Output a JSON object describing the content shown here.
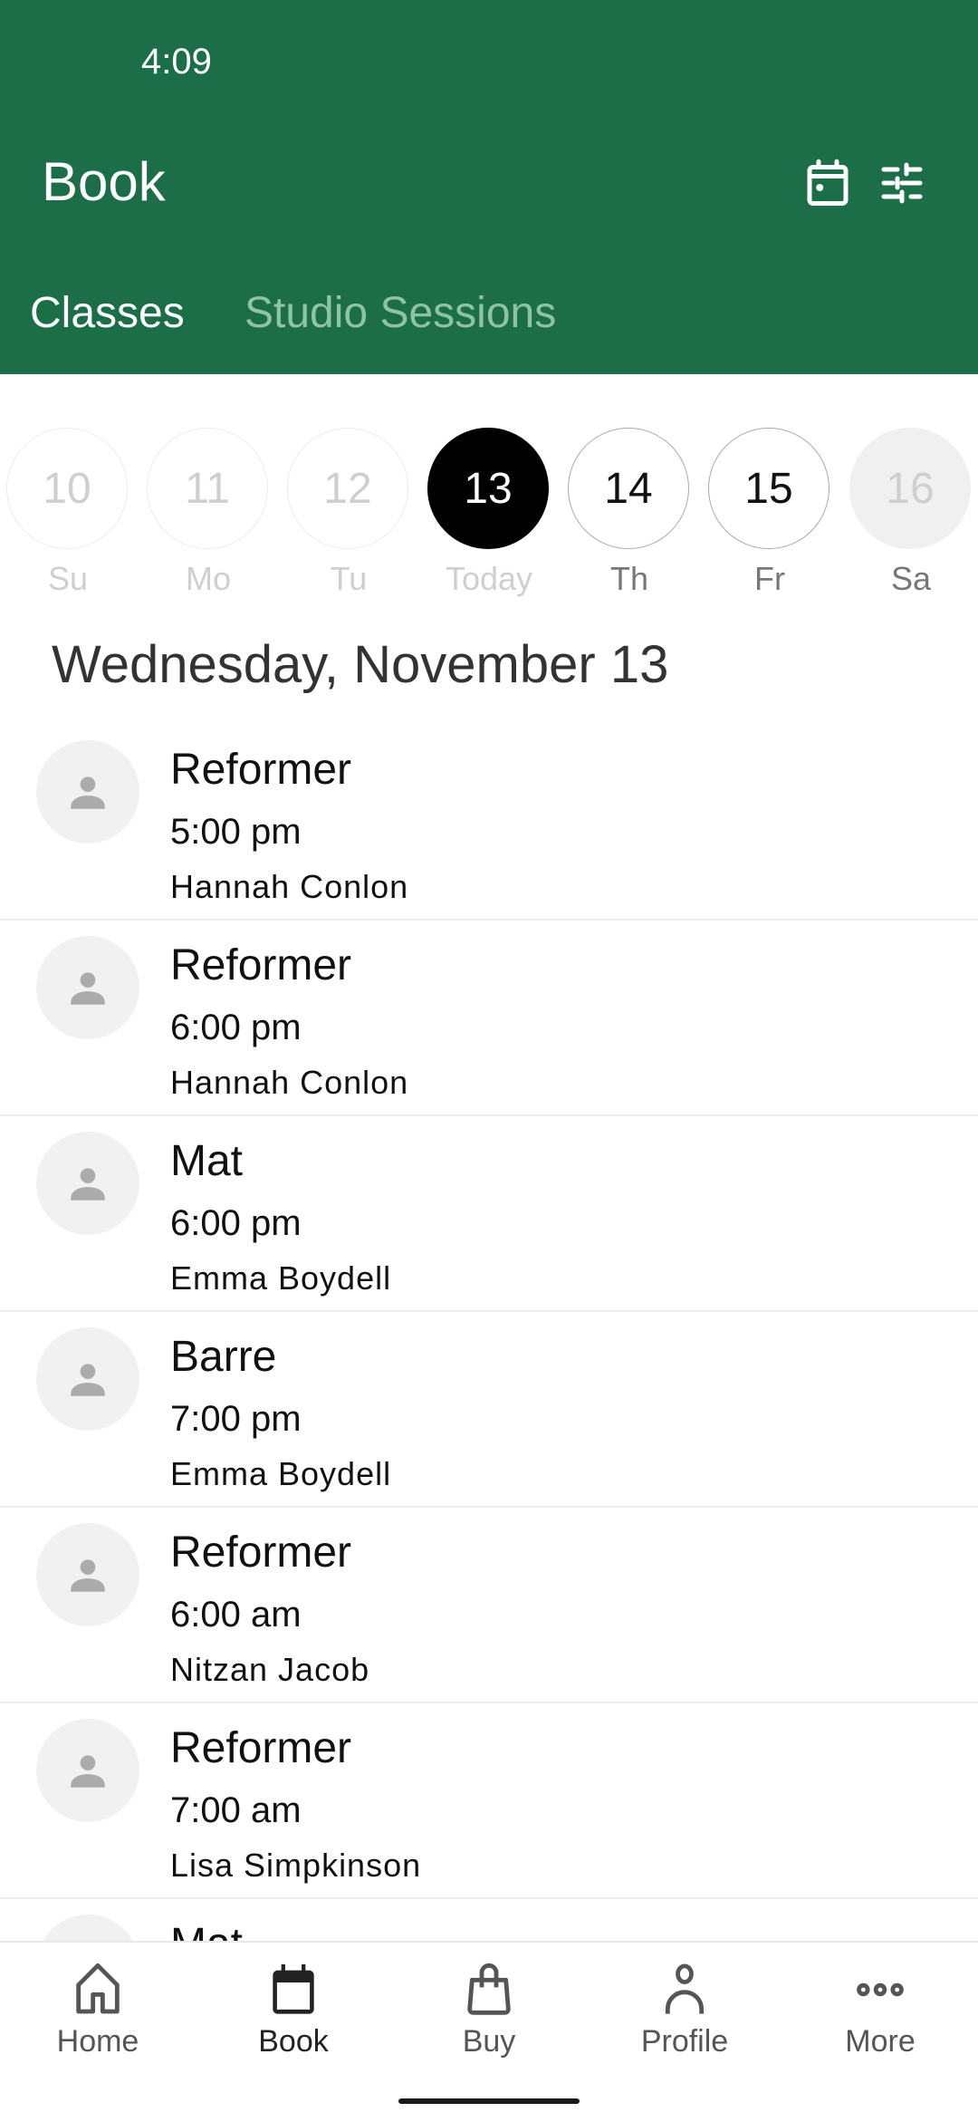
{
  "status_bar": {
    "time": "4:09"
  },
  "header": {
    "title": "Book",
    "icons": [
      "calendar-icon",
      "filter-sliders-icon"
    ],
    "tabs": [
      {
        "label": "Classes",
        "active": true
      },
      {
        "label": "Studio Sessions",
        "active": false
      }
    ],
    "color": "#1b6e47"
  },
  "date_strip": [
    {
      "num": "10",
      "label": "Su",
      "state": "past"
    },
    {
      "num": "11",
      "label": "Mo",
      "state": "past"
    },
    {
      "num": "12",
      "label": "Tu",
      "state": "past"
    },
    {
      "num": "13",
      "label": "Today",
      "state": "selected"
    },
    {
      "num": "14",
      "label": "Th",
      "state": "available"
    },
    {
      "num": "15",
      "label": "Fr",
      "state": "available"
    },
    {
      "num": "16",
      "label": "Sa",
      "state": "unavailable"
    }
  ],
  "date_heading": "Wednesday, November 13",
  "classes": [
    {
      "name": "Reformer",
      "time": "5:00 pm",
      "instructor": "Hannah Conlon"
    },
    {
      "name": "Reformer",
      "time": "6:00 pm",
      "instructor": "Hannah Conlon"
    },
    {
      "name": "Mat",
      "time": "6:00 pm",
      "instructor": "Emma Boydell"
    },
    {
      "name": "Barre",
      "time": "7:00 pm",
      "instructor": "Emma Boydell"
    },
    {
      "name": "Reformer",
      "time": "6:00 am",
      "instructor": "Nitzan Jacob"
    },
    {
      "name": "Reformer",
      "time": "7:00 am",
      "instructor": "Lisa Simpkinson"
    },
    {
      "name": "Mat",
      "time": "",
      "instructor": ""
    }
  ],
  "bottom_nav": [
    {
      "label": "Home",
      "icon": "home-icon",
      "active": false
    },
    {
      "label": "Book",
      "icon": "calendar-icon",
      "active": true
    },
    {
      "label": "Buy",
      "icon": "shopping-bag-icon",
      "active": false
    },
    {
      "label": "Profile",
      "icon": "person-icon",
      "active": false
    },
    {
      "label": "More",
      "icon": "more-dots-icon",
      "active": false
    }
  ]
}
